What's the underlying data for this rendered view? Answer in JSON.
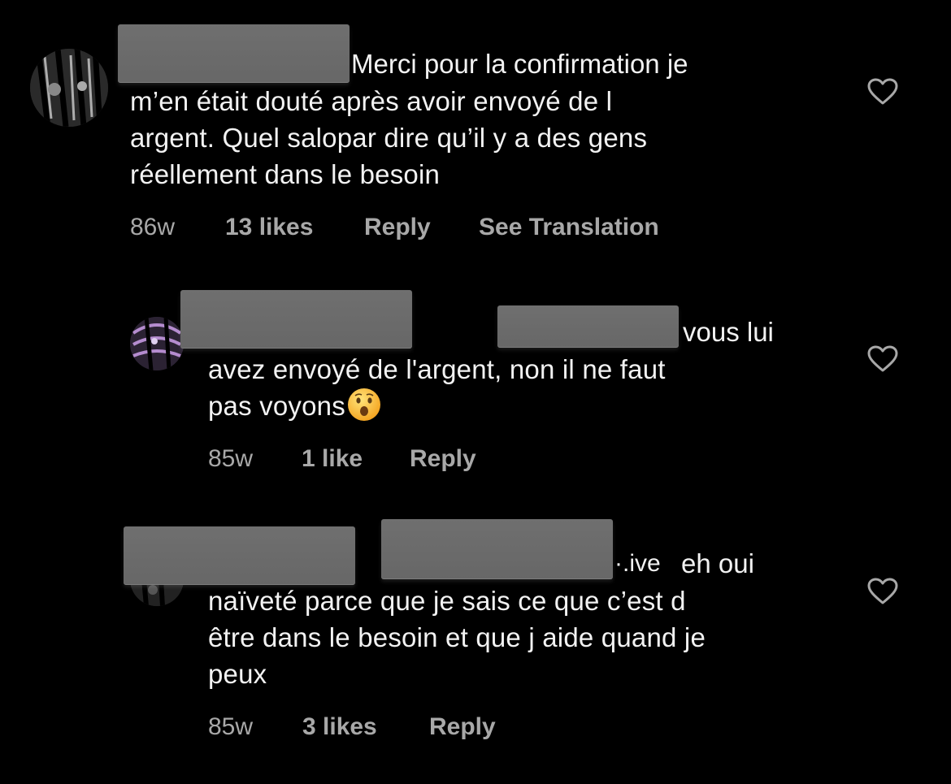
{
  "comments": [
    {
      "lead_text": "Merci pour la confirmation je",
      "lines": [
        "m’en était douté après avoir envoyé de l",
        "argent. Quel salopar dire qu’il y a des gens",
        "réellement dans le besoin"
      ],
      "time": "86w",
      "likes": "13 likes",
      "reply": "Reply",
      "translate": "See Translation"
    },
    {
      "lead_text": "vous lui",
      "lines": [
        "avez envoyé de l'argent, non il ne faut",
        "pas voyons"
      ],
      "emoji": "😮",
      "time": "85w",
      "likes": "1 like",
      "reply": "Reply"
    },
    {
      "lead_text": "eh oui",
      "lead_fragment": "·.ive",
      "lines": [
        "naïveté parce que je sais ce que c’est d",
        "être dans le besoin et que j aide quand je",
        "peux"
      ],
      "time": "85w",
      "likes": "3 likes",
      "reply": "Reply"
    }
  ],
  "colors": {
    "background": "#000000",
    "text": "#f2f2f2",
    "meta": "#a8a8a8",
    "redaction": "#6b6b6b"
  }
}
